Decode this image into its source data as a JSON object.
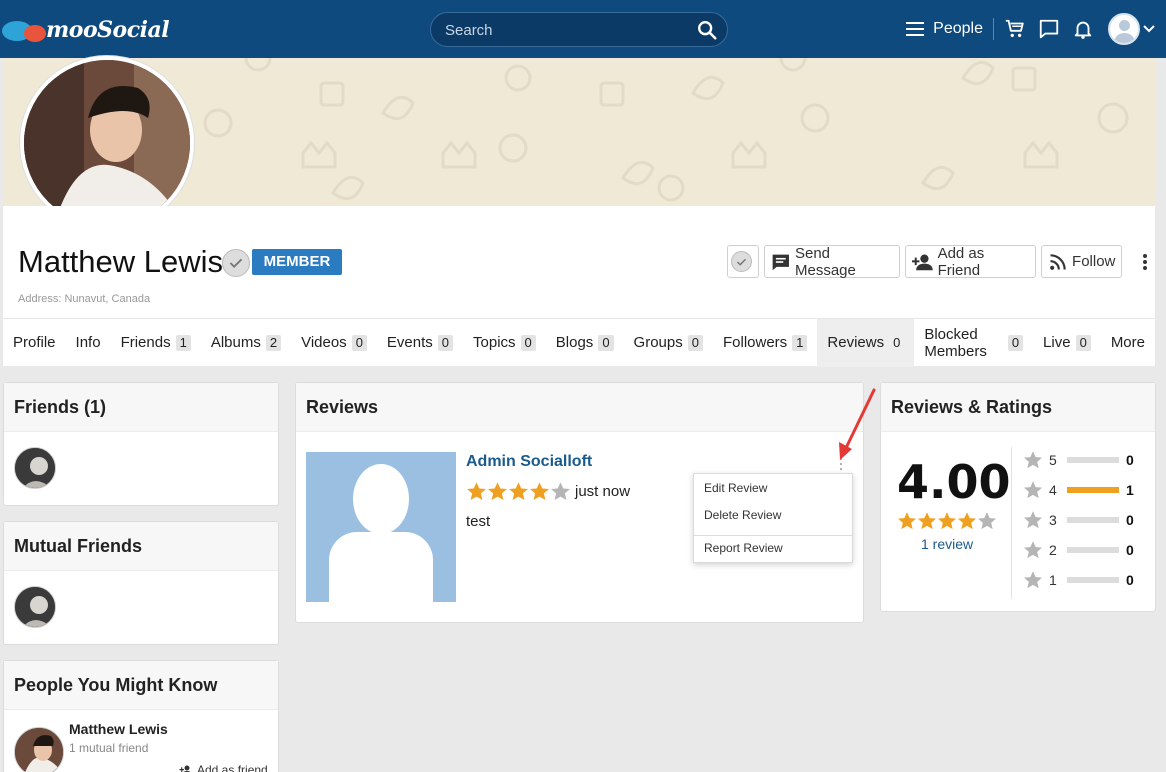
{
  "header": {
    "logo_text": "mooSocial",
    "search_placeholder": "Search",
    "people_label": "People"
  },
  "profile": {
    "name": "Matthew Lewis",
    "badge": "MEMBER",
    "address": "Address: Nunavut, Canada",
    "actions": {
      "send_message": "Send Message",
      "add_friend": "Add as Friend",
      "follow": "Follow"
    }
  },
  "tabs": [
    {
      "label": "Profile",
      "count": ""
    },
    {
      "label": "Info",
      "count": ""
    },
    {
      "label": "Friends",
      "count": "1"
    },
    {
      "label": "Albums",
      "count": "2"
    },
    {
      "label": "Videos",
      "count": "0"
    },
    {
      "label": "Events",
      "count": "0"
    },
    {
      "label": "Topics",
      "count": "0"
    },
    {
      "label": "Blogs",
      "count": "0"
    },
    {
      "label": "Groups",
      "count": "0"
    },
    {
      "label": "Followers",
      "count": "1"
    },
    {
      "label": "Reviews",
      "count": "0"
    },
    {
      "label": "Blocked Members",
      "count": "0"
    },
    {
      "label": "Live",
      "count": "0"
    },
    {
      "label": "More",
      "count": ""
    }
  ],
  "active_tab": "Reviews",
  "sidebar": {
    "friends_title": "Friends (1)",
    "mutual_title": "Mutual Friends",
    "pymk_title": "People You Might Know",
    "pymk_name": "Matthew Lewis",
    "pymk_mutual": "1 mutual friend",
    "pymk_add": "Add as friend"
  },
  "reviews": {
    "title": "Reviews",
    "author": "Admin Socialloft",
    "stars": 4,
    "time": "just now",
    "text": "test",
    "menu": {
      "edit": "Edit Review",
      "delete": "Delete Review",
      "report": "Report Review"
    }
  },
  "ratings": {
    "title": "Reviews & Ratings",
    "average": "4.00",
    "average_stars": 4,
    "review_count": "1 review",
    "rows": [
      {
        "level": "5",
        "count": "0",
        "fraction": 0
      },
      {
        "level": "4",
        "count": "1",
        "fraction": 1
      },
      {
        "level": "3",
        "count": "0",
        "fraction": 0
      },
      {
        "level": "2",
        "count": "0",
        "fraction": 0
      },
      {
        "level": "1",
        "count": "0",
        "fraction": 0
      }
    ]
  },
  "colors": {
    "topbar": "#0e4a7e",
    "accent_blue": "#2b7bc0",
    "star_gold": "#f0a020",
    "link": "#1a5b8e",
    "arrow_red": "#e53935"
  }
}
